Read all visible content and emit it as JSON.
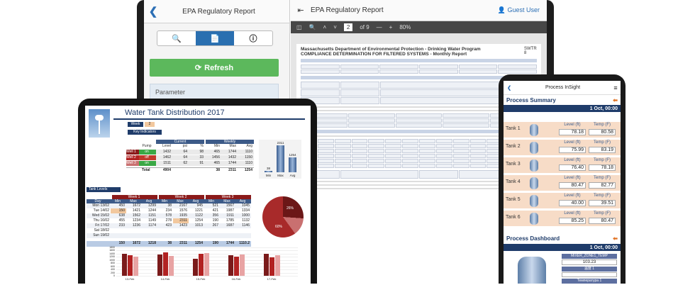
{
  "laptop": {
    "left_title": "EPA Regulatory Report",
    "refresh_label": "Refresh",
    "parameter_label": "Parameter",
    "right_title": "EPA Regulatory Report",
    "user_label": "Guest User",
    "pdf": {
      "page": "2",
      "of": "of 9",
      "zoom": "80%"
    },
    "doc_title": "Massachusetts Department of Environmental Protection - Drinking Water Program",
    "doc_subtitle": "COMPLIANCE DETERMINATION FOR FILTERED SYSTEMS - Monthly Report",
    "doc_code": "SWTR 8"
  },
  "tablet": {
    "title": "Water Tank Distribution 2017",
    "week_label": "Week",
    "week_value": "2",
    "key_indicators": "Key Indicators",
    "col_pump": "Pump",
    "col_current": "Current",
    "col_weekly": "Weekly",
    "sub_headers": [
      "Level",
      "psi",
      "%",
      "Min",
      "Max",
      "Avg"
    ],
    "rows": [
      {
        "name": "Well 1",
        "pump": "on",
        "vals": [
          "1432",
          "64",
          "98",
          "465",
          "1744",
          "1110"
        ],
        "color": "#8b1a1a"
      },
      {
        "name": "Well 2",
        "pump": "off",
        "vals": [
          "1462",
          "64",
          "33",
          "1456",
          "1432",
          "1150"
        ],
        "color": "#b22222"
      },
      {
        "name": "Well 3",
        "pump": "on",
        "vals": [
          "1511",
          "62",
          "91",
          "465",
          "1744",
          "1110"
        ],
        "color": "#c97070"
      }
    ],
    "total_label": "Total",
    "total_vals": [
      "4904",
      "",
      "",
      "38",
      "2311",
      "1254"
    ],
    "mini_bars": [
      {
        "label": "Min",
        "value": "38"
      },
      {
        "label": "Max",
        "value": "2311"
      },
      {
        "label": "Avg",
        "value": "1254"
      }
    ],
    "tank_levels": "Tank Levels",
    "week_headers": [
      "Week 1",
      "Week 2",
      "Week 3"
    ],
    "day_col": "Day",
    "mma": [
      "Min",
      "Max",
      "Avg"
    ],
    "days": [
      {
        "d": "Mon 13/02",
        "v": [
          "450",
          "1672",
          "1299",
          "38",
          "2167",
          "945",
          "521",
          "1567",
          "1045"
        ]
      },
      {
        "d": "Tue 14/02",
        "v": [
          "150",
          "1421",
          "1244",
          "234",
          "1576",
          "1221",
          "421",
          "1987",
          "1334"
        ]
      },
      {
        "d": "Wed 15/02",
        "v": [
          "638",
          "1562",
          "1151",
          "578",
          "1935",
          "1122",
          "356",
          "1911",
          "1000"
        ]
      },
      {
        "d": "Thu 16/02",
        "v": [
          "455",
          "1234",
          "1149",
          "278",
          "2311",
          "1254",
          "190",
          "1785",
          "1132"
        ]
      },
      {
        "d": "Fri 17/02",
        "v": [
          "233",
          "1236",
          "1174",
          "423",
          "1423",
          "1013",
          "267",
          "1687",
          "1146"
        ]
      },
      {
        "d": "Sat 18/02",
        "v": [
          "",
          "",
          "",
          "",
          "",
          "",
          "",
          "",
          ""
        ]
      },
      {
        "d": "Sun 19/02",
        "v": [
          "",
          "",
          "",
          "",
          "",
          "",
          "",
          "",
          ""
        ]
      }
    ],
    "totals": [
      "150",
      "1672",
      "1218",
      "38",
      "2311",
      "1254",
      "190",
      "1744",
      "1110.2"
    ],
    "pie": {
      "a": "26%",
      "b": "60%"
    },
    "bar_values": [
      1400,
      1300,
      1200,
      1350,
      1500,
      1250,
      1100,
      1400,
      1450,
      1300,
      1200,
      1350,
      1400,
      1150,
      1300
    ],
    "bar_axis": [
      "1800",
      "1600",
      "1400",
      "1200",
      "1000",
      "800",
      "600",
      "400",
      "200",
      "0"
    ],
    "bar_dates": [
      "13-Feb",
      "14-Feb",
      "15-Feb",
      "16-Feb",
      "17-Feb"
    ]
  },
  "phone": {
    "app_title": "Process InSight",
    "summary": "Process Summary",
    "date": "1 Oct, 00:00",
    "level_label": "Level (ft)",
    "temp_label": "Temp (F)",
    "tanks": [
      {
        "name": "Tank 1",
        "level": "78.18",
        "temp": "80.58"
      },
      {
        "name": "Tank 2",
        "level": "75.99",
        "temp": "83.19"
      },
      {
        "name": "Tank 3",
        "level": "76.40",
        "temp": "78.18"
      },
      {
        "name": "Tank 4",
        "level": "80.47",
        "temp": "82.77"
      },
      {
        "name": "Tank 5",
        "level": "40.00",
        "temp": "39.51"
      },
      {
        "name": "Tank 6",
        "level": "85.25",
        "temp": "80.47"
      }
    ],
    "dashboard": "Process Dashboard",
    "dash_date": "1 Oct, 00:00",
    "mixer": "MIXER_ZONE1_TEMP",
    "mixer_val": "103.23",
    "label2": "温度 1",
    "label3": "Температура 1"
  }
}
